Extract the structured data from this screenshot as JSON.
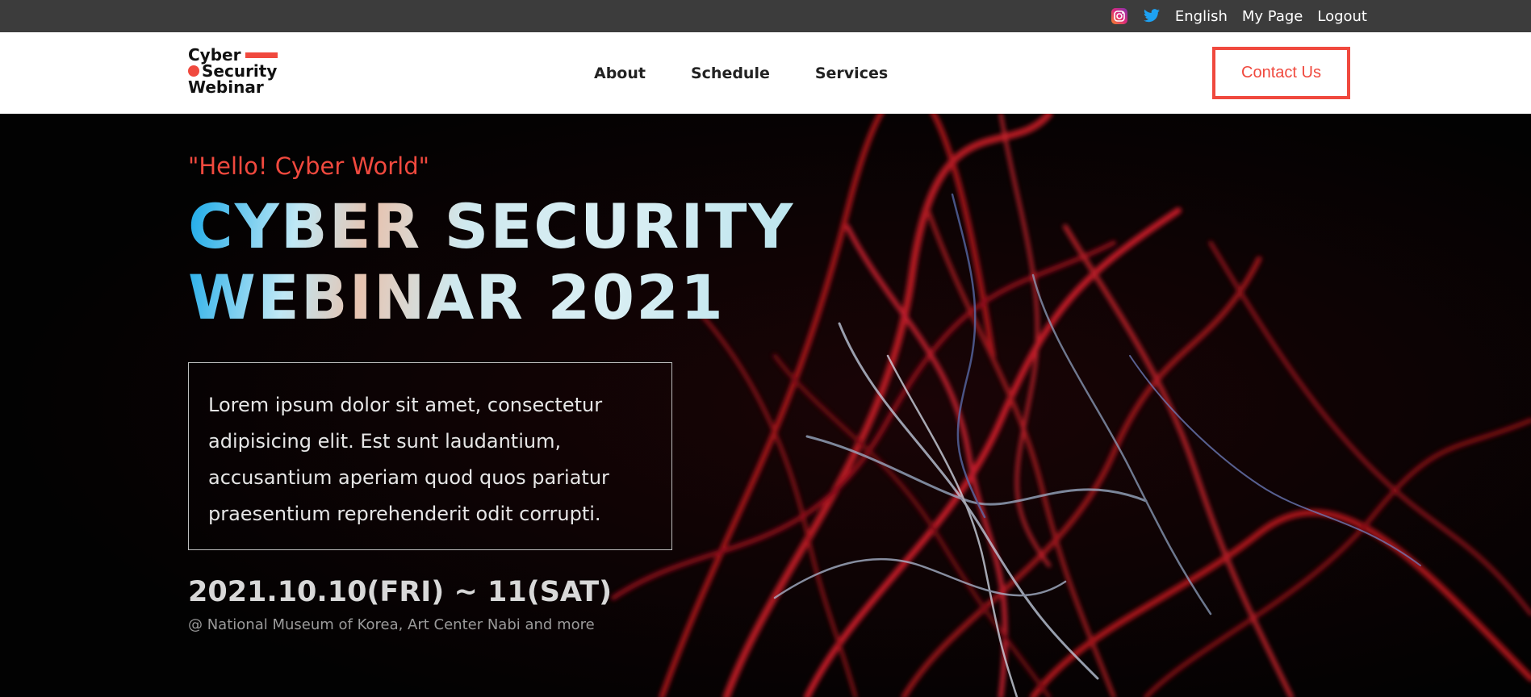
{
  "topbar": {
    "instagram_icon": "instagram-icon",
    "twitter_icon": "twitter-icon",
    "language": "English",
    "mypage": "My Page",
    "logout": "Logout"
  },
  "header": {
    "logo_line1": "Cyber",
    "logo_line2": "Security",
    "logo_line3": "Webinar",
    "nav": [
      "About",
      "Schedule",
      "Services"
    ],
    "contact": "Contact Us"
  },
  "hero": {
    "greeting": "\"Hello! Cyber World\"",
    "title_line1": "CYBER SECURITY",
    "title_line2": "WEBINAR 2021",
    "description": "Lorem ipsum dolor sit amet, consectetur adipisicing elit. Est sunt laudantium, accusantium aperiam quod quos pariatur praesentium reprehenderit odit corrupti.",
    "date": "2021.10.10(FRI) ~ 11(SAT)",
    "venue": "@ National Museum of Korea, Art Center Nabi and more"
  },
  "colors": {
    "accent": "#f0493e",
    "topbar_bg": "#3c3c3c",
    "twitter": "#1da1f2"
  }
}
